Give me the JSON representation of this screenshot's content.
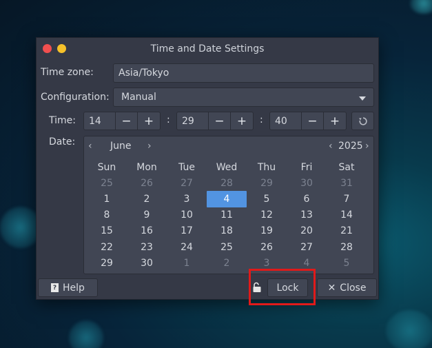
{
  "window": {
    "title": "Time and Date Settings"
  },
  "timezone": {
    "label": "Time zone:",
    "value": "Asia/Tokyo"
  },
  "configuration": {
    "label": "Configuration:",
    "value": "Manual"
  },
  "time": {
    "label": "Time:",
    "hour": "14",
    "minute": "29",
    "second": "40",
    "separator": ":",
    "minus": "−",
    "plus": "+"
  },
  "date": {
    "label": "Date:",
    "month": "June",
    "year": "2025",
    "prev": "‹",
    "next": "›",
    "weekdays": [
      "Sun",
      "Mon",
      "Tue",
      "Wed",
      "Thu",
      "Fri",
      "Sat"
    ],
    "selected_day": "4",
    "weeks": [
      [
        {
          "d": "25",
          "o": true
        },
        {
          "d": "26",
          "o": true
        },
        {
          "d": "27",
          "o": true
        },
        {
          "d": "28",
          "o": true
        },
        {
          "d": "29",
          "o": true
        },
        {
          "d": "30",
          "o": true
        },
        {
          "d": "31",
          "o": true
        }
      ],
      [
        {
          "d": "1"
        },
        {
          "d": "2"
        },
        {
          "d": "3"
        },
        {
          "d": "4",
          "s": true
        },
        {
          "d": "5"
        },
        {
          "d": "6"
        },
        {
          "d": "7"
        }
      ],
      [
        {
          "d": "8"
        },
        {
          "d": "9"
        },
        {
          "d": "10"
        },
        {
          "d": "11"
        },
        {
          "d": "12"
        },
        {
          "d": "13"
        },
        {
          "d": "14"
        }
      ],
      [
        {
          "d": "15"
        },
        {
          "d": "16"
        },
        {
          "d": "17"
        },
        {
          "d": "18"
        },
        {
          "d": "19"
        },
        {
          "d": "20"
        },
        {
          "d": "21"
        }
      ],
      [
        {
          "d": "22"
        },
        {
          "d": "23"
        },
        {
          "d": "24"
        },
        {
          "d": "25"
        },
        {
          "d": "26"
        },
        {
          "d": "27"
        },
        {
          "d": "28"
        }
      ],
      [
        {
          "d": "29"
        },
        {
          "d": "30"
        },
        {
          "d": "1",
          "o": true
        },
        {
          "d": "2",
          "o": true
        },
        {
          "d": "3",
          "o": true
        },
        {
          "d": "4",
          "o": true
        },
        {
          "d": "5",
          "o": true
        }
      ]
    ]
  },
  "buttons": {
    "help": "Help",
    "help_icon": "?",
    "lock": "Lock",
    "close": "Close",
    "close_icon": "✕"
  },
  "icons": {
    "reset": "reset-icon",
    "lock": "unlocked-padlock-icon",
    "dropdown": "chevron-down-icon"
  },
  "colors": {
    "accent": "#5294e2",
    "highlight": "#e01a1a",
    "window_bg": "#353946"
  }
}
